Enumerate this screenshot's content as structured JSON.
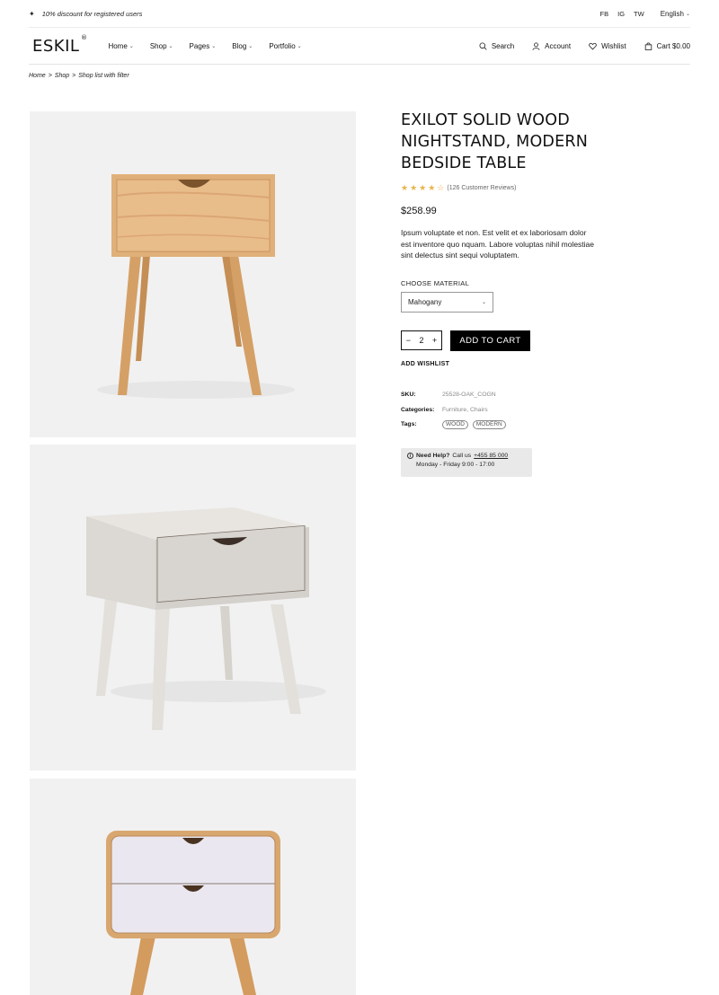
{
  "topbar": {
    "promo": "10% discount for registered users",
    "social": [
      "FB",
      "IG",
      "TW"
    ],
    "language": "English"
  },
  "header": {
    "logo": "ESKIL",
    "logo_mark": "®",
    "nav": [
      {
        "label": "Home"
      },
      {
        "label": "Shop"
      },
      {
        "label": "Pages"
      },
      {
        "label": "Blog"
      },
      {
        "label": "Portfolio"
      }
    ],
    "search": "Search",
    "account": "Account",
    "wishlist": "Wishlist",
    "cart": "Cart $0.00"
  },
  "breadcrumb": {
    "items": [
      "Home",
      "Shop",
      "Shop list with filter"
    ],
    "separator": ">"
  },
  "product": {
    "title": "EXILOT SOLID WOOD NIGHTSTAND, MODERN BEDSIDE TABLE",
    "rating": 4,
    "rating_max": 5,
    "reviews": "(126 Customer Reviews)",
    "price": "$258.99",
    "description": "Ipsum voluptate et non. Est velit et ex laboriosam dolor est inventore quo nquam. Labore voluptas nihil molestiae sint delectus sint sequi voluptatem.",
    "material_label": "CHOOSE MATERIAL",
    "material_selected": "Mahogany",
    "quantity": "2",
    "qty_minus": "−",
    "qty_plus": "+",
    "add_to_cart": "ADD TO CART",
    "add_wishlist": "ADD WISHLIST",
    "meta": {
      "sku_label": "SKU:",
      "sku": "25528-OAK_COGN",
      "categories_label": "Categories:",
      "categories": "Furniture, Chairs",
      "tags_label": "Tags:",
      "tags": [
        "WOOD",
        "MODERN"
      ]
    },
    "help": {
      "title": "Need Help?",
      "call": "Call us",
      "phone": "+455 85 000",
      "hours": "Monday - Friday 9:00 - 17:00"
    }
  },
  "colors": {
    "accent": "#000000",
    "star": "#e8b44a",
    "image_bg": "#f1f1f1"
  }
}
